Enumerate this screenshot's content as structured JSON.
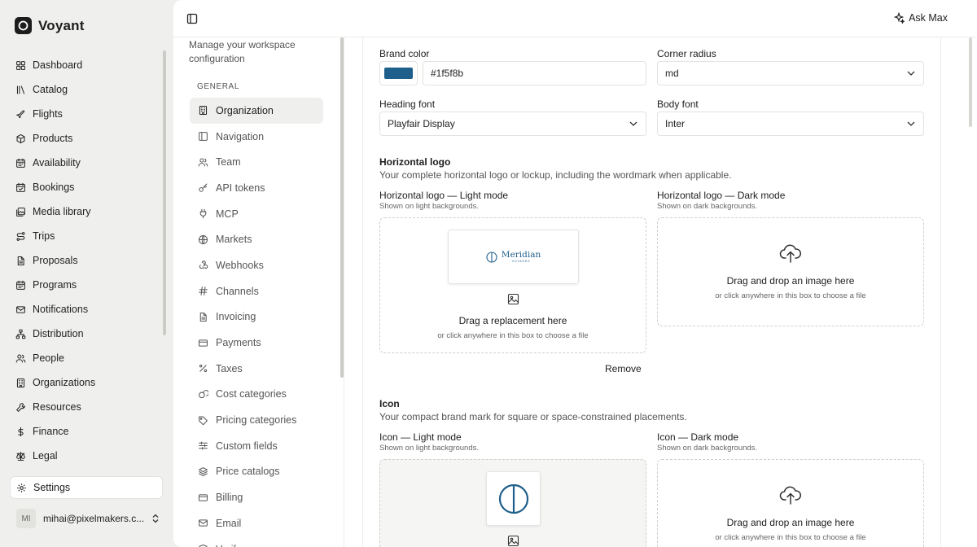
{
  "app": {
    "name": "Voyant"
  },
  "sidebar": {
    "items": [
      {
        "label": "Dashboard",
        "icon": "dashboard-icon"
      },
      {
        "label": "Catalog",
        "icon": "catalog-icon"
      },
      {
        "label": "Flights",
        "icon": "plane-icon"
      },
      {
        "label": "Products",
        "icon": "package-icon"
      },
      {
        "label": "Availability",
        "icon": "calendar-icon"
      },
      {
        "label": "Bookings",
        "icon": "calendar-check-icon"
      },
      {
        "label": "Media library",
        "icon": "images-icon"
      },
      {
        "label": "Trips",
        "icon": "route-icon"
      },
      {
        "label": "Proposals",
        "icon": "document-icon"
      },
      {
        "label": "Programs",
        "icon": "calendar-icon"
      },
      {
        "label": "Notifications",
        "icon": "mail-icon"
      },
      {
        "label": "Distribution",
        "icon": "network-icon"
      },
      {
        "label": "People",
        "icon": "users-icon"
      },
      {
        "label": "Organizations",
        "icon": "building-icon"
      },
      {
        "label": "Resources",
        "icon": "wrench-icon"
      },
      {
        "label": "Finance",
        "icon": "dollar-icon"
      },
      {
        "label": "Legal",
        "icon": "scale-icon"
      }
    ],
    "settings_label": "Settings",
    "user": {
      "initials": "MI",
      "email": "mihai@pixelmakers.c..."
    }
  },
  "topbar": {
    "ask_label": "Ask Max"
  },
  "settings_nav": {
    "description": "Manage your workspace configuration",
    "group_label": "GENERAL",
    "items": [
      {
        "label": "Organization",
        "icon": "building-icon",
        "active": true
      },
      {
        "label": "Navigation",
        "icon": "sidebar-icon"
      },
      {
        "label": "Team",
        "icon": "users-icon"
      },
      {
        "label": "API tokens",
        "icon": "key-icon"
      },
      {
        "label": "MCP",
        "icon": "plug-icon"
      },
      {
        "label": "Markets",
        "icon": "globe-icon"
      },
      {
        "label": "Webhooks",
        "icon": "webhook-icon"
      },
      {
        "label": "Channels",
        "icon": "hash-icon"
      },
      {
        "label": "Invoicing",
        "icon": "document-icon"
      },
      {
        "label": "Payments",
        "icon": "card-icon"
      },
      {
        "label": "Taxes",
        "icon": "percent-icon"
      },
      {
        "label": "Cost categories",
        "icon": "coins-icon"
      },
      {
        "label": "Pricing categories",
        "icon": "tag-icon"
      },
      {
        "label": "Custom fields",
        "icon": "sliders-icon"
      },
      {
        "label": "Price catalogs",
        "icon": "layers-icon"
      },
      {
        "label": "Billing",
        "icon": "card-icon"
      },
      {
        "label": "Email",
        "icon": "mail-icon"
      },
      {
        "label": "Verif...",
        "icon": "shield-icon"
      }
    ]
  },
  "form": {
    "brand_color_label": "Brand color",
    "brand_color_value": "#1f5f8b",
    "corner_radius_label": "Corner radius",
    "corner_radius_value": "md",
    "heading_font_label": "Heading font",
    "heading_font_value": "Playfair Display",
    "body_font_label": "Body font",
    "body_font_value": "Inter"
  },
  "horizontal_logo": {
    "title": "Horizontal logo",
    "description": "Your complete horizontal logo or lockup, including the wordmark when applicable.",
    "light": {
      "title": "Horizontal logo — Light mode",
      "desc": "Shown on light backgrounds.",
      "preview_text": "Meridian",
      "preview_subtext": "VOYAGES",
      "drop_title": "Drag a replacement here",
      "drop_sub": "or click anywhere in this box to choose a file"
    },
    "dark": {
      "title": "Horizontal logo — Dark mode",
      "desc": "Shown on dark backgrounds.",
      "drop_title": "Drag and drop an image here",
      "drop_sub": "or click anywhere in this box to choose a file"
    },
    "remove_label": "Remove"
  },
  "icon_section": {
    "title": "Icon",
    "description": "Your compact brand mark for square or space-constrained placements.",
    "light": {
      "title": "Icon — Light mode",
      "desc": "Shown on light backgrounds."
    },
    "dark": {
      "title": "Icon — Dark mode",
      "desc": "Shown on dark backgrounds.",
      "drop_title": "Drag and drop an image here",
      "drop_sub": "or click anywhere in this box to choose a file"
    }
  },
  "colors": {
    "brand": "#1f5f8b",
    "sidebar_bg": "#efefed"
  }
}
